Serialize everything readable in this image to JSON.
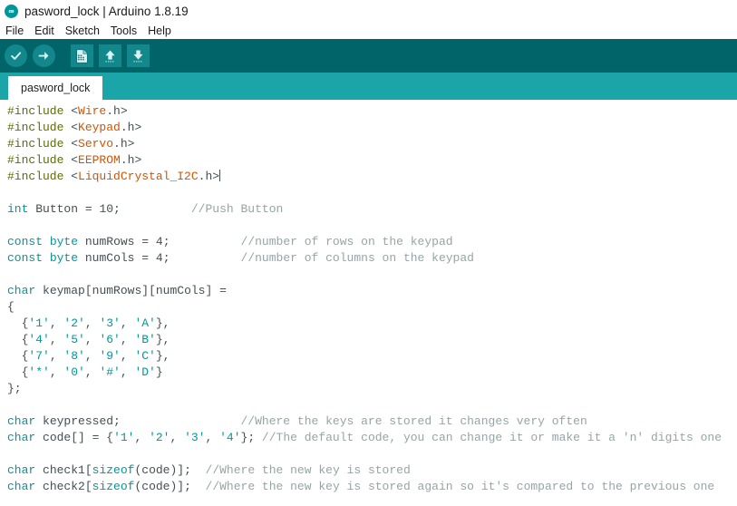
{
  "window": {
    "title": "pasword_lock | Arduino 1.8.19",
    "logo_name": "arduino-logo-icon"
  },
  "menu": {
    "items": [
      {
        "label": "File"
      },
      {
        "label": "Edit"
      },
      {
        "label": "Sketch"
      },
      {
        "label": "Tools"
      },
      {
        "label": "Help"
      }
    ]
  },
  "toolbar": {
    "verify_label": "Verify",
    "upload_label": "Upload",
    "new_label": "New",
    "open_label": "Open",
    "save_label": "Save",
    "background_color": "#006468",
    "button_color": "#12878c"
  },
  "tabs": {
    "active": "pasword_lock",
    "items": [
      {
        "label": "pasword_lock"
      }
    ]
  },
  "editor": {
    "background_color": "#ffffff",
    "text_color": "#434f54",
    "comment_color": "#95a5a6",
    "keyword_color": "#00979c",
    "preprocessor_color": "#5e6d03",
    "library_color": "#d35400",
    "lines": [
      "#include <Wire.h>",
      "#include <Keypad.h>",
      "#include <Servo.h>",
      "#include <EEPROM.h>",
      "#include <LiquidCrystal_I2C.h>",
      "",
      "int Button = 10;          //Push Button",
      "",
      "const byte numRows = 4;          //number of rows on the keypad",
      "const byte numCols = 4;          //number of columns on the keypad",
      "",
      "char keymap[numRows][numCols] =",
      "{",
      "  {'1', '2', '3', 'A'},",
      "  {'4', '5', '6', 'B'},",
      "  {'7', '8', '9', 'C'},",
      "  {'*', '0', '#', 'D'}",
      "};",
      "",
      "char keypressed;                 //Where the keys are stored it changes very often",
      "char code[] = {'1', '2', '3', '4'}; //The default code, you can change it or make it a 'n' digits one",
      "",
      "char check1[sizeof(code)];  //Where the new key is stored",
      "char check2[sizeof(code)];  //Where the new key is stored again so it's compared to the previous one"
    ]
  }
}
